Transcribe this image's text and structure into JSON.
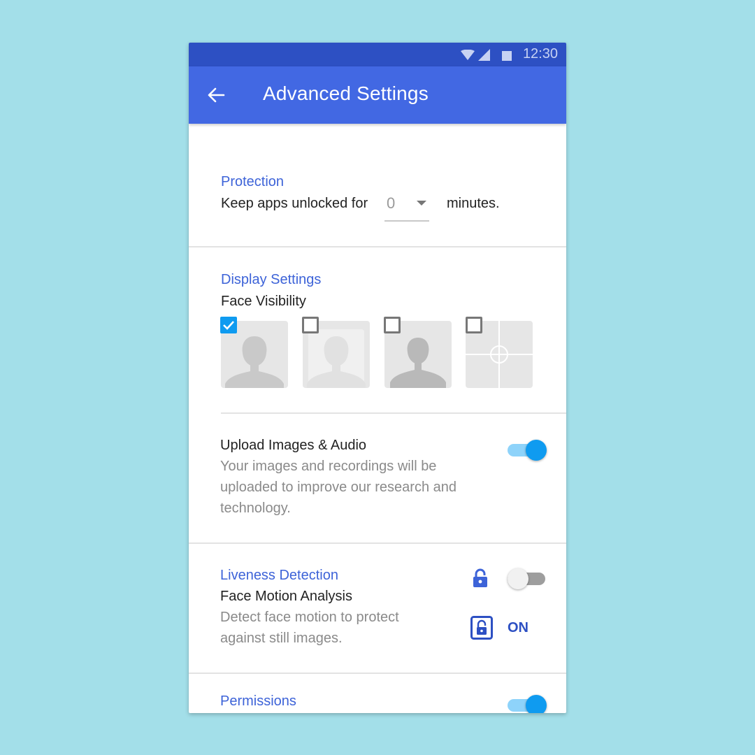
{
  "status_bar": {
    "time": "12:30",
    "icons": [
      "wifi-icon",
      "signal-icon",
      "battery-icon"
    ]
  },
  "app_bar": {
    "title": "Advanced Settings",
    "back_icon": "arrow-left-icon"
  },
  "protection": {
    "title": "Protection",
    "keep_unlocked_prefix": "Keep apps unlocked for",
    "dropdown_value": "0",
    "keep_unlocked_suffix": "minutes."
  },
  "display_settings": {
    "title": "Display Settings",
    "face_visibility_label": "Face Visibility",
    "options": [
      {
        "name": "face-solid",
        "checked": true
      },
      {
        "name": "face-faded",
        "checked": false
      },
      {
        "name": "face-silhouette",
        "checked": false
      },
      {
        "name": "crosshair-only",
        "checked": false
      }
    ]
  },
  "upload": {
    "title": "Upload Images & Audio",
    "line1": "Your images and recordings will be",
    "line2": "uploaded to improve our research and",
    "line3": "technology.",
    "toggle_on": true
  },
  "liveness": {
    "title": "Liveness Detection",
    "subtitle": "Face Motion Analysis",
    "line1": "Detect face motion to protect",
    "line2": "against still images.",
    "toggle_on": false,
    "lock_icon": "lock-icon",
    "status_label": "ON"
  },
  "permissions": {
    "title": "Permissions",
    "toggle_on": true
  },
  "colors": {
    "accent": "#4268e3",
    "statusbar": "#2d50c3",
    "toggle_blue": "#0f9bf0",
    "background": "#a3dfe9"
  }
}
